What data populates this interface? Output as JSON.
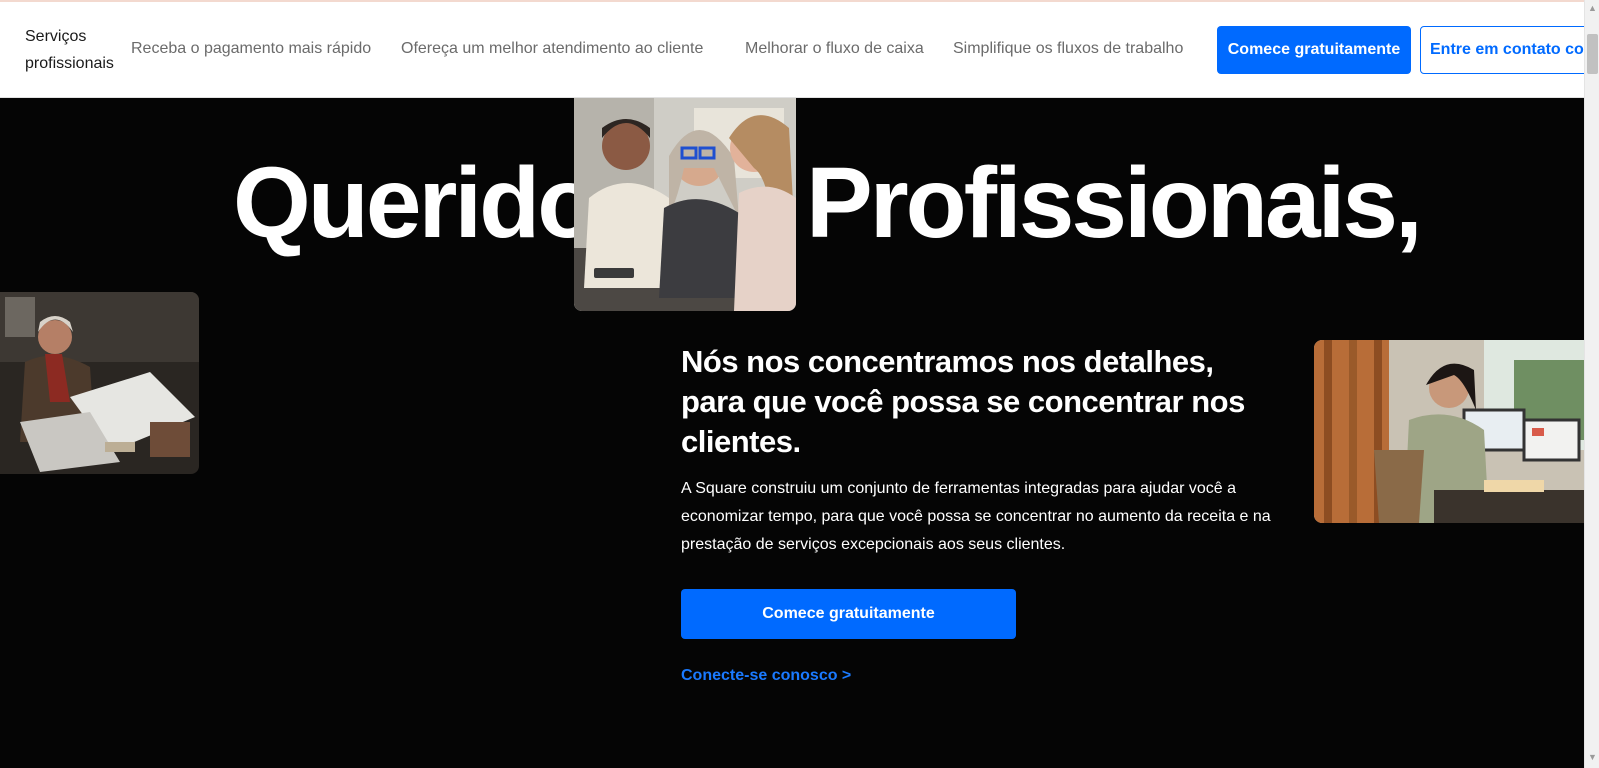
{
  "nav": {
    "brand": "Serviços profissionais",
    "links": [
      "Receba o pagamento mais rápido",
      "Ofereça um melhor atendimento ao cliente",
      "Melhorar o fluxo de caixa",
      "Simplifique os fluxos de trabalho"
    ],
    "primary_cta": "Comece gratuitamente",
    "secondary_cta": "Entre em contato conosco"
  },
  "hero": {
    "headline_left": "Querido",
    "headline_right": "Profissionais,",
    "subheading": "Nós nos concentramos nos detalhes, para que você possa se concentrar nos clientes.",
    "body": "A Square construiu um conjunto de ferramentas integradas para ajudar você a economizar tempo, para que você possa se concentrar no aumento da receita e na prestação de serviços excepcionais aos seus clientes.",
    "cta_button": "Comece gratuitamente",
    "cta_link": "Conecte-se conosco >"
  },
  "colors": {
    "accent": "#006aff",
    "hero_background": "#050505",
    "nav_text": "#6b6b6b"
  },
  "icons": {
    "scroll_up": "triangle-up",
    "scroll_down": "triangle-down"
  }
}
